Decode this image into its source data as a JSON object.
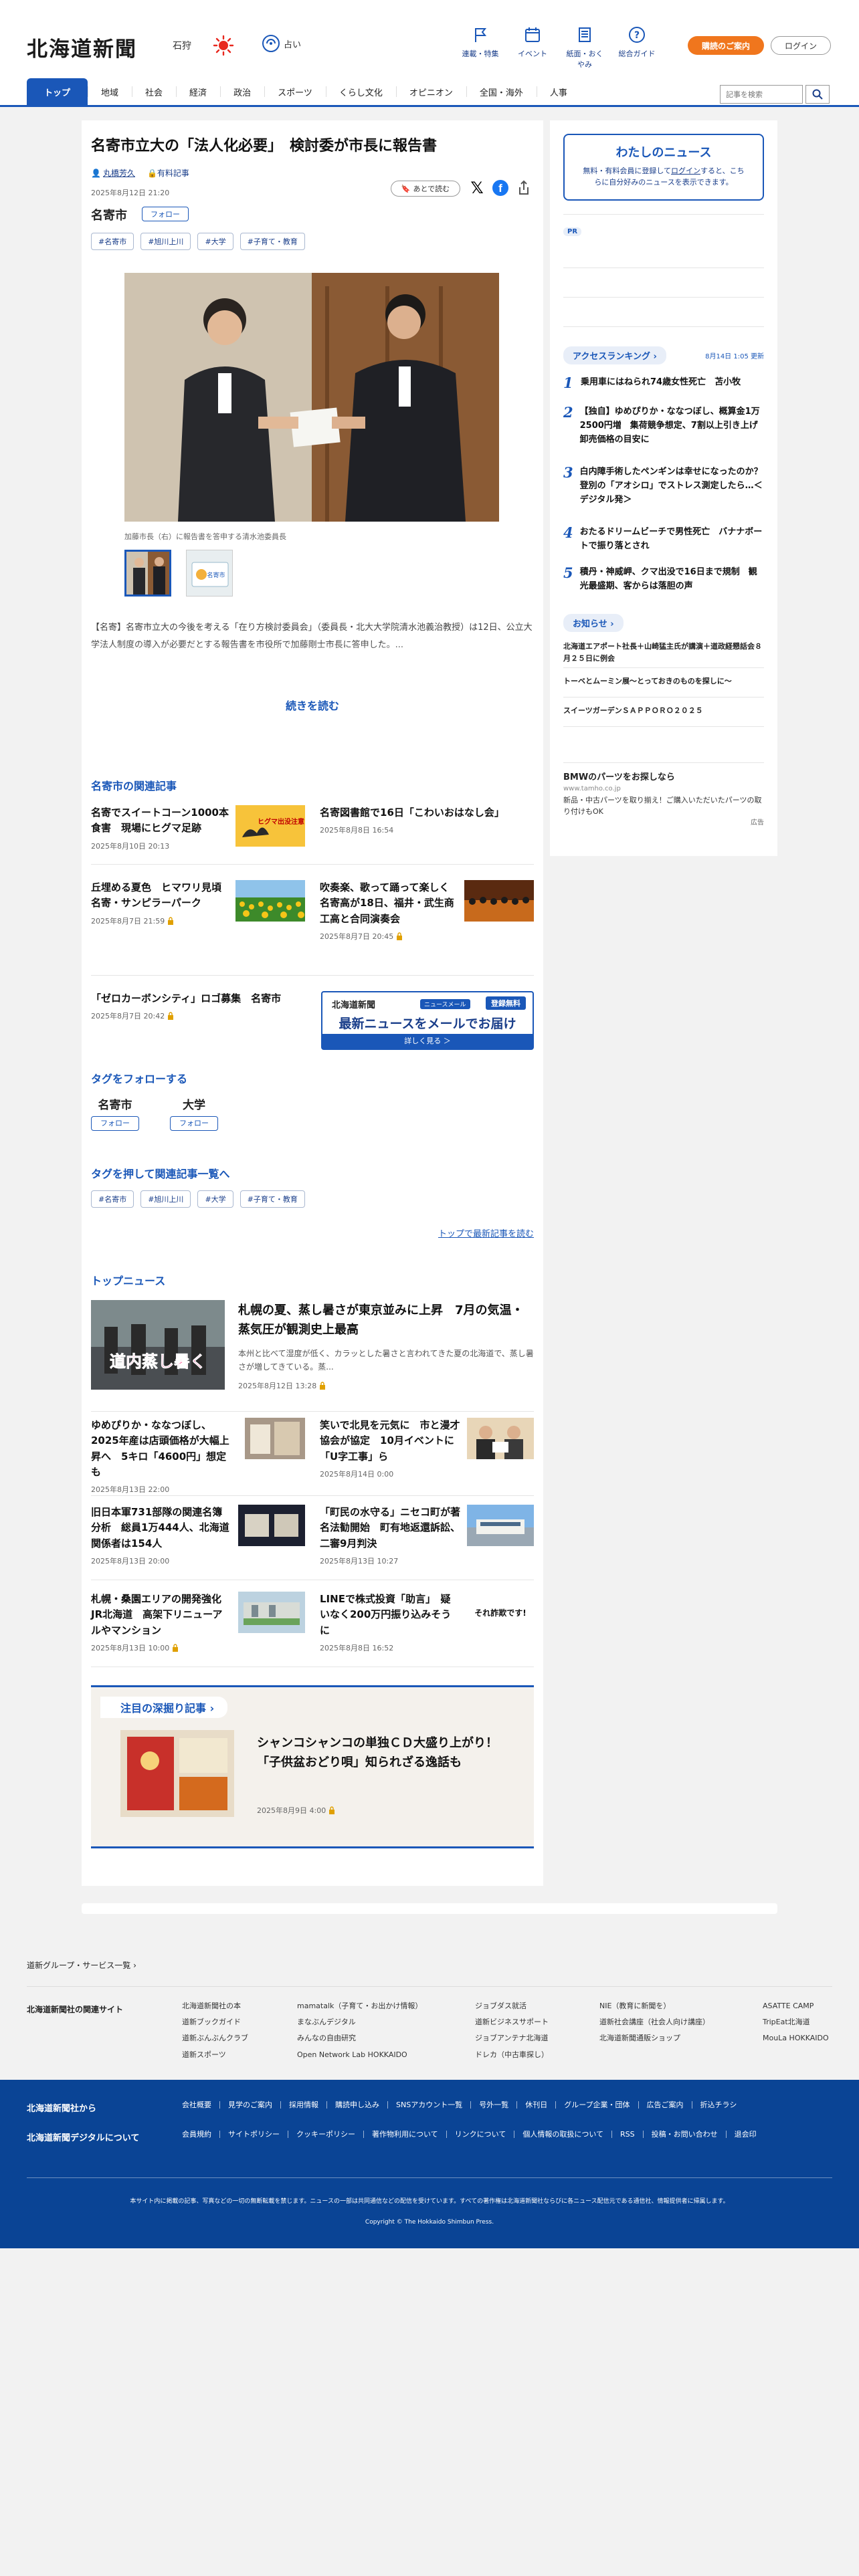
{
  "header": {
    "logo": "北海道新聞",
    "region": "石狩",
    "fortune_label": "占い",
    "util_nav": [
      {
        "label": "連載・特集",
        "icon": "flag-icon"
      },
      {
        "label": "イベント",
        "icon": "calendar-icon"
      },
      {
        "label": "紙面・おくやみ",
        "icon": "newspaper-icon"
      },
      {
        "label": "総合ガイド",
        "icon": "help-icon"
      }
    ],
    "guide_button": "購読のご案内",
    "login_button": "ログイン"
  },
  "gnav": {
    "items": [
      "トップ",
      "地域",
      "社会",
      "経済",
      "政治",
      "スポーツ",
      "くらし文化",
      "オピニオン",
      "全国・海外",
      "人事"
    ],
    "search_placeholder": "記事を検索"
  },
  "article": {
    "title": "名寄市立大の「法人化必要」　検討委が市長に報告書",
    "author": "丸橋芳久",
    "author_badge": "有料記事",
    "pubdate": "2025年8月12日 21:20",
    "later_button": "あとで読む",
    "location": "名寄市",
    "follow_label": "フォロー",
    "tags": [
      "#名寄市",
      "#旭川上川",
      "#大学",
      "#子育て・教育"
    ],
    "photo_caption": "加藤市長（右）に報告書を答申する清水池委員長",
    "thumb2_text": "名寄市",
    "lead": "【名寄】名寄市立大の今後を考える「在り方検討委員会」（委員長・北大大学院清水池義治教授）は12日、公立大学法人制度の導入が必要だとする報告書を市役所で加藤剛士市長に答申した。...",
    "read_more": "続きを読む"
  },
  "related": {
    "heading": "名寄市の関連記事",
    "items": [
      {
        "title": "名寄でスイートコーン1000本食害　現場にヒグマ足跡",
        "date": "2025年8月10日 20:13",
        "thumb_text": "ヒグマ出没注意",
        "locked": false
      },
      {
        "title": "名寄図書館で16日「こわいおはなし会」",
        "date": "2025年8月8日 16:54",
        "locked": false
      },
      {
        "title": "丘埋める夏色　ヒマワリ見頃　名寄・サンピラーパーク",
        "date": "2025年8月7日 21:59",
        "locked": true
      },
      {
        "title": "吹奏楽、歌って踊って楽しく　名寄高が18日、福井・武生商工高と合同演奏会",
        "date": "2025年8月7日 20:45",
        "locked": true
      },
      {
        "title": "「ゼロカーボンシティ」ロゴ募集　名寄市",
        "date": "2025年8月7日 20:42",
        "locked": true
      }
    ]
  },
  "mail_banner": {
    "logo": "北海道新聞",
    "tag": "ニュースメール",
    "free": "登録無料",
    "main": "最新ニュースをメールでお届け",
    "cta": "詳しく見る ＞"
  },
  "follow_tags": {
    "heading": "タグをフォローする",
    "items": [
      {
        "name": "名寄市",
        "button": "フォロー"
      },
      {
        "name": "大学",
        "button": "フォロー"
      }
    ]
  },
  "tag_list": {
    "heading": "タグを押して関連記事一覧へ",
    "tags": [
      "#名寄市",
      "#旭川上川",
      "#大学",
      "#子育て・教育"
    ],
    "latest_link": "トップで最新記事を読む"
  },
  "top_news": {
    "heading": "トップニュース",
    "lead": {
      "title": "札幌の夏、蒸し暑さが東京並みに上昇　7月の気温・蒸気圧が観測史上最高",
      "desc": "本州と比べて湿度が低く、カラッとした暑さと言われてきた夏の北海道で、蒸し暑さが増してきている。蒸...",
      "date": "2025年8月12日 13:28",
      "img_text": "道内蒸し暑く"
    },
    "items": [
      {
        "title": "ゆめぴりか・ななつぼし、2025年産は店頭価格が大幅上昇へ　5キロ「4600円」想定も",
        "date": "2025年8月13日 22:00",
        "locked": false
      },
      {
        "title": "笑いで北見を元気に　市と漫才協会が協定　10月イベントに「U字工事」ら",
        "date": "2025年8月14日 0:00",
        "locked": false
      },
      {
        "title": "旧日本軍731部隊の関連名簿分析　総員1万444人、北海道関係者は154人",
        "date": "2025年8月13日 20:00",
        "locked": false
      },
      {
        "title": "「町民の水守る」ニセコ町が著名法勧開始　町有地返還訴訟、二審9月判決",
        "date": "2025年8月13日 10:27",
        "locked": false
      },
      {
        "title": "札幌・桑園エリアの開発強化　JR北海道　高架下リニューアルやマンション",
        "date": "2025年8月13日 10:00",
        "locked": true
      },
      {
        "title": "LINEで株式投資「助言」　疑いなく200万円振り込みそうに",
        "date": "2025年8月8日 16:52",
        "locked": false,
        "thumb_text": "それ詐欺です!"
      }
    ]
  },
  "deep": {
    "heading": "注目の深掘り記事",
    "title": "シャンコシャンコの単独ＣＤ大盛り上がり！「子供盆おどり唄」知られざる逸話も",
    "date": "2025年8月9日 4:00"
  },
  "sidebar": {
    "mynews_title": "わたしのニュース",
    "mynews_text_1": "無料・有料会員に登録して",
    "mynews_login": "ログイン",
    "mynews_text_2": "すると、こちらに自分好みのニュースを表示できます。",
    "pr_label": "PR",
    "ranking_heading": "アクセスランキング",
    "ranking_update": "8月14日 1:05 更新",
    "ranking": [
      {
        "no": "1",
        "title": "乗用車にはねられ74歳女性死亡　苫小牧"
      },
      {
        "no": "2",
        "title": "【独自】ゆめぴりか・ななつぼし、概算金1万2500円増　集荷競争想定、7割以上引き上げ　卸売価格の目安に"
      },
      {
        "no": "3",
        "title": "白内障手術したペンギンは幸せになったのか？　登別の「アオシロ」でストレス測定したら…＜デジタル発＞"
      },
      {
        "no": "4",
        "title": "おたるドリームビーチで男性死亡　バナナボートで振り落とされ"
      },
      {
        "no": "5",
        "title": "積丹・神威岬、クマ出没で16日まで規制　観光最盛期、客からは落胆の声"
      }
    ],
    "notice_heading": "お知らせ",
    "notices": [
      "北海道エアポート社長＋山崎猛主氏が講演＋道政経懇話会８月２５日に例会",
      "トーベとムーミン展〜とっておきのものを探しに〜",
      "スイーツガーデンＳＡＰＰＯＲＯ２０２５"
    ],
    "ad": {
      "title": "BMWのパーツをお探しなら",
      "url": "www.tamho.co.jp",
      "text": "新品・中古パーツを取り揃え！ご購入いただいたパーツの取り付けもOK",
      "mark": "広告"
    }
  },
  "footer": {
    "group_link": "道新グループ・サービス一覧",
    "related_label": "北海道新聞社の関連サイト",
    "cols": [
      [
        "北海道新聞社の本",
        "道新ブックガイド",
        "道新ぶんぶんクラブ",
        "道新スポーツ"
      ],
      [
        "mamatalk（子育て・お出かけ情報）",
        "まなぶんデジタル",
        "みんなの自由研究",
        "Open Network Lab HOKKAIDO"
      ],
      [
        "ジョブダス就活",
        "道新ビジネスサポート",
        "ジョブアンテナ北海道",
        "ドレカ（中古車探し）"
      ],
      [
        "NIE（教育に新聞を）",
        "道新社会講座（社会人向け講座）",
        "北海道新聞通販ショップ"
      ],
      [
        "ASATTE CAMP",
        "TripEat北海道",
        "MouLa HOKKAIDO"
      ]
    ],
    "blue_label_1": "北海道新聞社から",
    "blue_label_2": "北海道新聞デジタルについて",
    "links_1": [
      "会社概要",
      "見学のご案内",
      "採用情報",
      "購読申し込み",
      "SNSアカウント一覧",
      "号外一覧",
      "休刊日",
      "グループ企業・団体",
      "広告ご案内",
      "折込チラシ"
    ],
    "links_2": [
      "会員規約",
      "サイトポリシー",
      "クッキーポリシー",
      "著作物利用について",
      "リンクについて",
      "個人情報の取扱について",
      "RSS",
      "投稿・お問い合わせ",
      "退会印"
    ],
    "note": "本サイト内に掲載の記事、写真などの一切の無断転載を禁じます。ニュースの一部は共同通信などの配信を受けています。すべての著作権は北海道新聞社ならびに各ニュース配信元である通信社、情報提供者に帰属します。",
    "copyright": "Copyright © The Hokkaido Shimbun Press."
  },
  "colors": {
    "brand_blue": "#1a57b8",
    "accent_orange": "#f0761d",
    "footer_blue": "#0a4495"
  }
}
